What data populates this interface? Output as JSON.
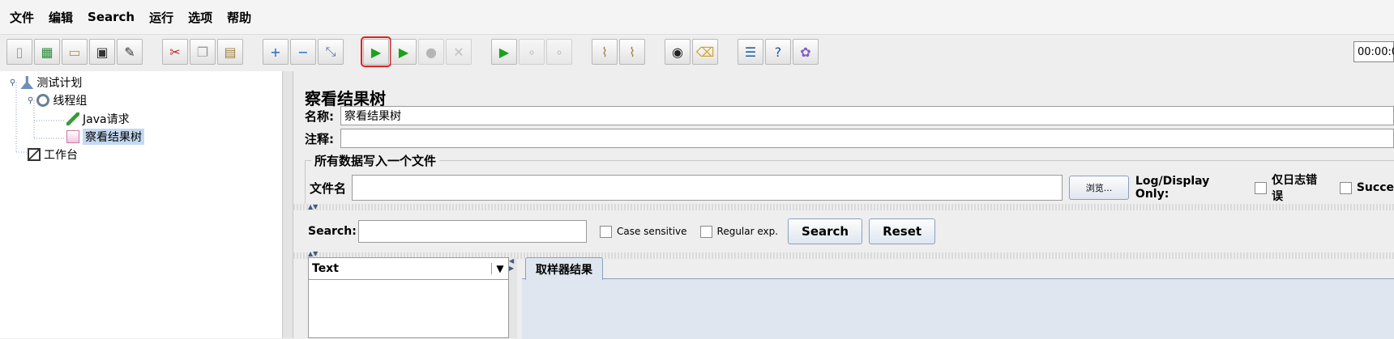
{
  "menu": [
    "文件",
    "编辑",
    "Search",
    "运行",
    "选项",
    "帮助"
  ],
  "toolbar": {
    "timer": "00:00:0",
    "buttons": [
      {
        "name": "new-icon",
        "glyph": "▯"
      },
      {
        "name": "templates-icon",
        "glyph": "▦"
      },
      {
        "name": "open-icon",
        "glyph": "▭"
      },
      {
        "name": "save-icon",
        "glyph": "▣"
      },
      {
        "name": "save-as-icon",
        "glyph": "✎"
      },
      {
        "name": "cut-icon",
        "glyph": "✂"
      },
      {
        "name": "copy-icon",
        "glyph": "❐"
      },
      {
        "name": "paste-icon",
        "glyph": "▤"
      },
      {
        "name": "expand-icon",
        "glyph": "+"
      },
      {
        "name": "collapse-icon",
        "glyph": "−"
      },
      {
        "name": "toggle-icon",
        "glyph": "⤡"
      },
      {
        "name": "start-icon",
        "glyph": "▶"
      },
      {
        "name": "start-no-pause-icon",
        "glyph": "▶"
      },
      {
        "name": "stop-icon",
        "glyph": "●"
      },
      {
        "name": "shutdown-icon",
        "glyph": "✕"
      },
      {
        "name": "remote-start-icon",
        "glyph": "▶"
      },
      {
        "name": "remote-stop-icon",
        "glyph": "∘"
      },
      {
        "name": "remote-shutdown-icon",
        "glyph": "∘"
      },
      {
        "name": "clear-icon",
        "glyph": "⌇"
      },
      {
        "name": "clear-all-icon",
        "glyph": "⌇"
      },
      {
        "name": "search-binoculars-icon",
        "glyph": "◉"
      },
      {
        "name": "reset-search-broom-icon",
        "glyph": "⌫"
      },
      {
        "name": "function-helper-icon",
        "glyph": "☰"
      },
      {
        "name": "help-icon",
        "glyph": "?"
      },
      {
        "name": "logger-icon",
        "glyph": "✿"
      }
    ]
  },
  "tree": [
    {
      "label": "测试计划",
      "depth": 0
    },
    {
      "label": "线程组",
      "depth": 1
    },
    {
      "label": "Java请求",
      "depth": 2
    },
    {
      "label": "察看结果树",
      "depth": 2,
      "selected": true
    },
    {
      "label": "工作台",
      "depth": 0
    }
  ],
  "panel": {
    "title": "察看结果树",
    "name_label": "名称:",
    "name_value": "察看结果树",
    "comment_label": "注释:",
    "comment_value": "",
    "group_title": "所有数据写入一个文件",
    "filename_label": "文件名",
    "filename_value": "",
    "browse_button": "浏览...",
    "log_display_label": "Log/Display Only:",
    "errors_only_label": "仅日志错误",
    "success_label": "Succe",
    "search_label": "Search:",
    "search_value": "",
    "case_sensitive_label": "Case sensitive",
    "regex_label": "Regular exp.",
    "search_button": "Search",
    "reset_button": "Reset",
    "renderer_value": "Text",
    "tab_sampler_result": "取样器结果"
  }
}
